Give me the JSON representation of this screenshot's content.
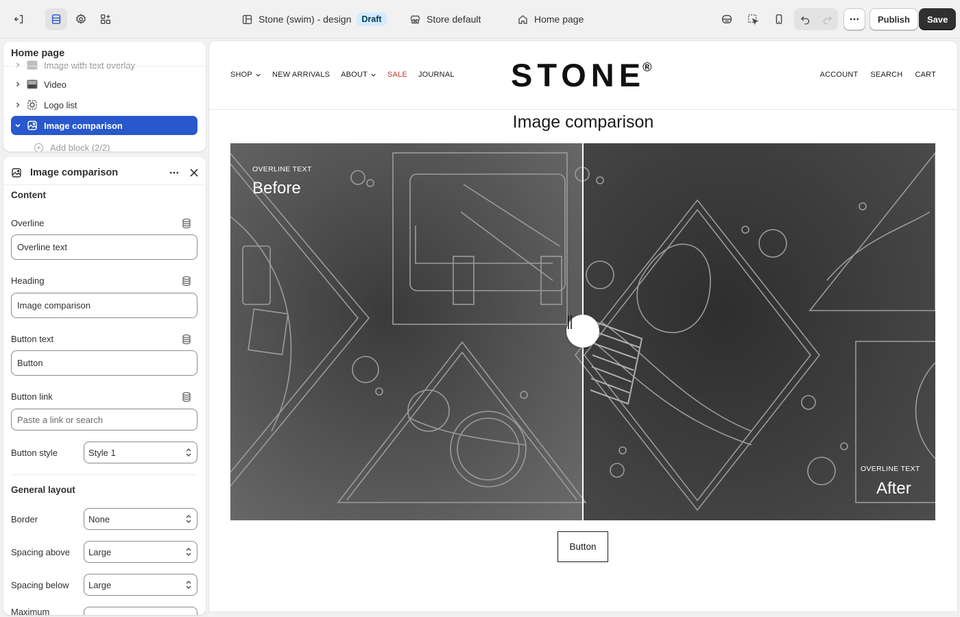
{
  "topbar": {
    "theme_name": "Stone (swim) - design",
    "draft_badge": "Draft",
    "store_label": "Store default",
    "page_label": "Home page",
    "publish_label": "Publish",
    "save_label": "Save"
  },
  "tree": {
    "title": "Home page",
    "items": [
      {
        "label": "Image with text overlay",
        "icon": "image-icon"
      },
      {
        "label": "Video",
        "icon": "video-icon"
      },
      {
        "label": "Logo list",
        "icon": "logo-icon"
      },
      {
        "label": "Image comparison",
        "icon": "image-compare-icon"
      },
      {
        "label": "Add block (2/2)",
        "icon": "plus-circle-icon"
      }
    ]
  },
  "settings": {
    "title": "Image comparison",
    "content_section": "Content",
    "overline_label": "Overline",
    "overline_value": "Overline text",
    "heading_label": "Heading",
    "heading_value": "Image comparison",
    "button_text_label": "Button text",
    "button_text_value": "Button",
    "button_link_label": "Button link",
    "button_link_placeholder": "Paste a link or search",
    "button_style_label": "Button style",
    "button_style_value": "Style 1",
    "layout_section": "General layout",
    "border_label": "Border",
    "border_value": "None",
    "spacing_above_label": "Spacing above",
    "spacing_above_value": "Large",
    "spacing_below_label": "Spacing below",
    "spacing_below_value": "Large",
    "max_label": "Maximum"
  },
  "preview": {
    "nav_left": [
      "SHOP",
      "NEW ARRIVALS",
      "ABOUT",
      "SALE",
      "JOURNAL"
    ],
    "nav_right": [
      "ACCOUNT",
      "SEARCH",
      "CART"
    ],
    "logo": "STONE",
    "logo_mark": "®",
    "heading": "Image comparison",
    "before_overline": "OVERLINE TEXT",
    "before_label": "Before",
    "after_overline": "OVERLINE TEXT",
    "after_label": "After",
    "button": "Button",
    "sale_color": "#c0392b"
  },
  "colors": {
    "accent": "#2858cc",
    "dark_button": "#303030"
  }
}
